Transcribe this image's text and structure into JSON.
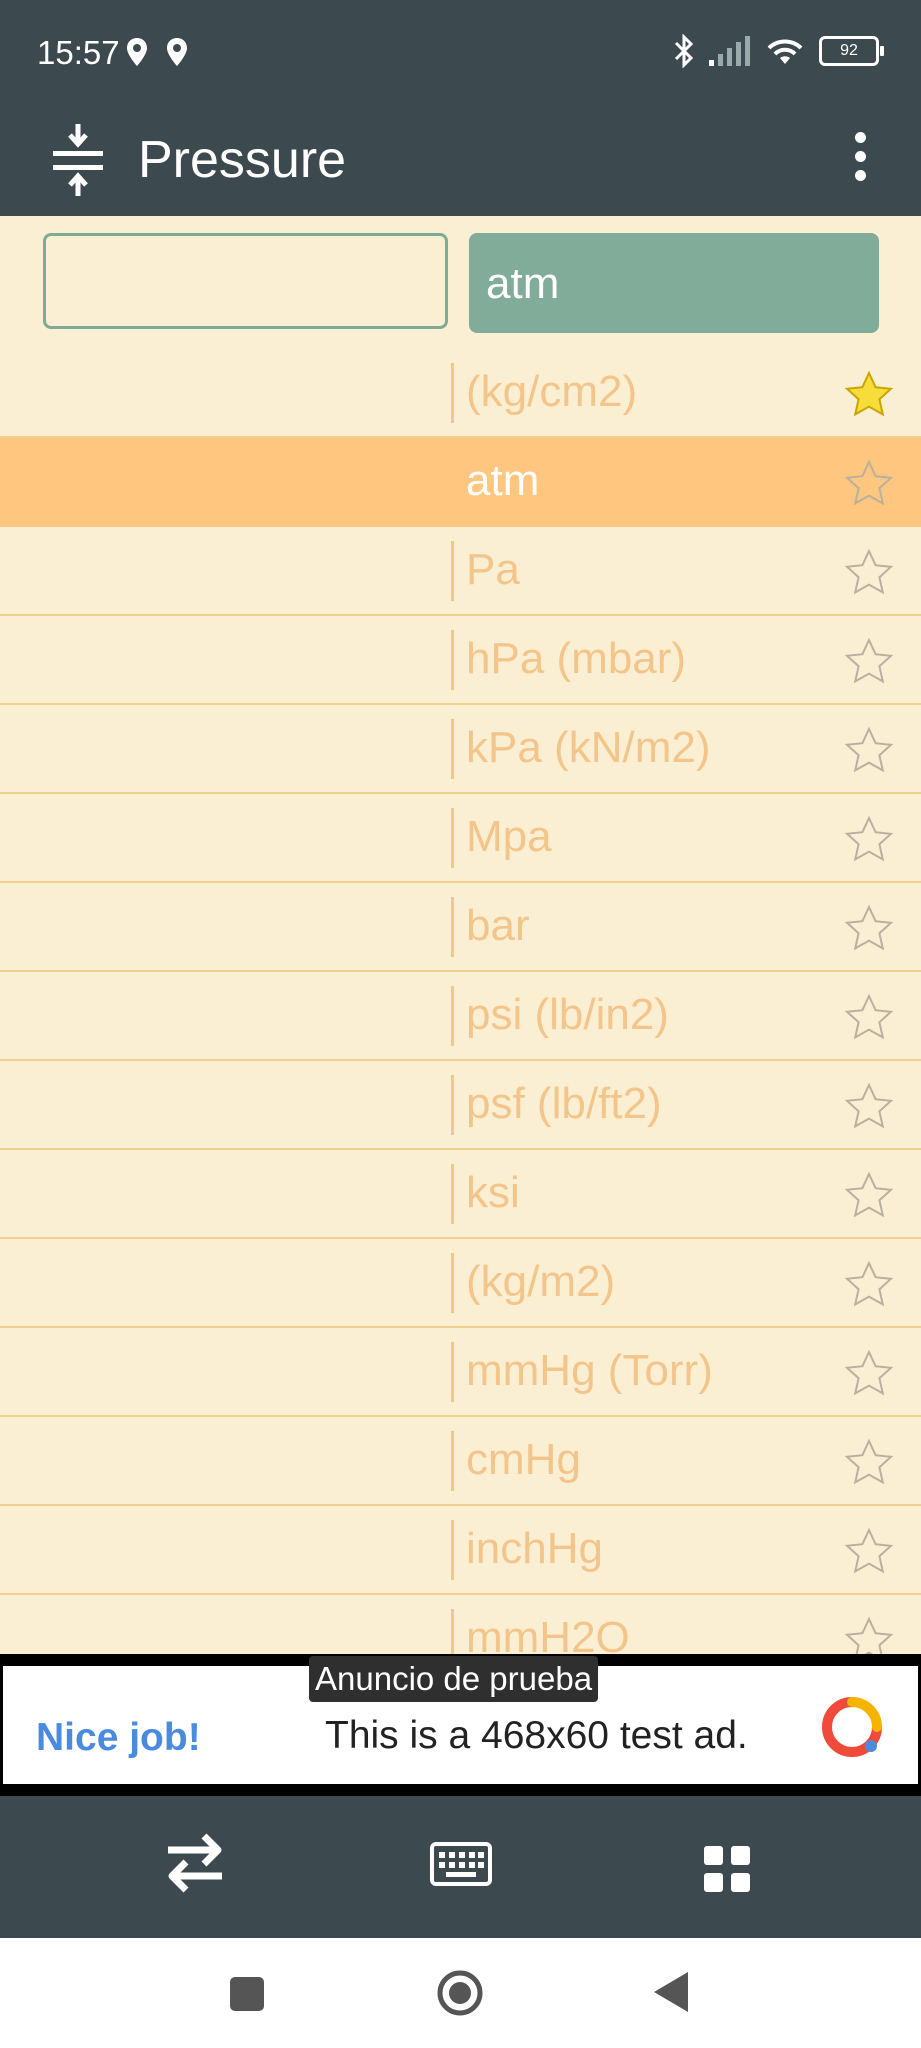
{
  "status": {
    "time": "15:57",
    "battery": "92"
  },
  "app_bar": {
    "title": "Pressure",
    "app_icon": "compress-icon",
    "menu_icon": "more-vert-icon"
  },
  "converter": {
    "input_value": "",
    "selected_unit": "atm"
  },
  "units": [
    {
      "label": "(kg/cm2)",
      "favorite": true,
      "selected": false
    },
    {
      "label": "atm",
      "favorite": false,
      "selected": true
    },
    {
      "label": "Pa",
      "favorite": false,
      "selected": false
    },
    {
      "label": "hPa (mbar)",
      "favorite": false,
      "selected": false
    },
    {
      "label": "kPa (kN/m2)",
      "favorite": false,
      "selected": false
    },
    {
      "label": "Mpa",
      "favorite": false,
      "selected": false
    },
    {
      "label": "bar",
      "favorite": false,
      "selected": false
    },
    {
      "label": "psi (lb/in2)",
      "favorite": false,
      "selected": false
    },
    {
      "label": "psf (lb/ft2)",
      "favorite": false,
      "selected": false
    },
    {
      "label": "ksi",
      "favorite": false,
      "selected": false
    },
    {
      "label": "(kg/m2)",
      "favorite": false,
      "selected": false
    },
    {
      "label": "mmHg (Torr)",
      "favorite": false,
      "selected": false
    },
    {
      "label": "cmHg",
      "favorite": false,
      "selected": false
    },
    {
      "label": "inchHg",
      "favorite": false,
      "selected": false
    },
    {
      "label": "mmH2O",
      "favorite": false,
      "selected": false
    }
  ],
  "ad": {
    "label": "Anuncio de prueba",
    "headline": "Nice job!",
    "text": "This is a 468x60 test ad."
  },
  "toolbar": {
    "icons": [
      "swap-icon",
      "keyboard-icon",
      "grid-icon"
    ]
  },
  "nav": {
    "icons": [
      "recents-icon",
      "home-icon",
      "back-icon"
    ]
  },
  "colors": {
    "bar": "#3c4a50",
    "background": "#fbefd3",
    "accent": "#80ac99",
    "selected_row": "#fec67f",
    "star_filled": "#f8dc3a",
    "unit_text": "#f3c58a"
  }
}
